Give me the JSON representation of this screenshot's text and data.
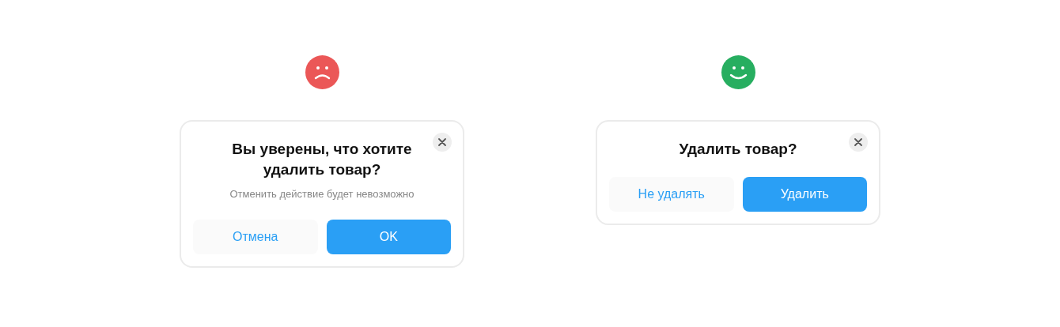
{
  "dialogs": [
    {
      "face": {
        "kind": "sad",
        "color": "#eb5757"
      },
      "title": "Вы уверены, что хотите удалить товар?",
      "subtitle": "Отменить действие будет невозможно",
      "buttons": [
        {
          "label": "Отмена",
          "kind": "secondary"
        },
        {
          "label": "OK",
          "kind": "primary"
        }
      ]
    },
    {
      "face": {
        "kind": "happy",
        "color": "#27ae60"
      },
      "title": "Удалить товар?",
      "buttons": [
        {
          "label": "Не удалять",
          "kind": "secondary"
        },
        {
          "label": "Удалить",
          "kind": "primary"
        }
      ]
    }
  ]
}
